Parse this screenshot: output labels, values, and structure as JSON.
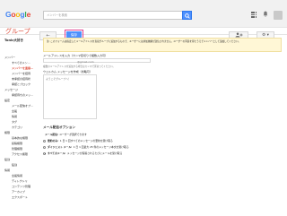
{
  "header": {
    "logo": "Google",
    "search_placeholder": "メンバーを検索",
    "app_name": "グループ"
  },
  "toolbar": {
    "back_label": "←",
    "save_label": "保存",
    "add_label": "+",
    "settings_label": "⚙ ▾"
  },
  "sidebar": {
    "group_title": "Tonic大好き",
    "items": [
      {
        "label": "メンバー",
        "kind": "cat"
      },
      {
        "label": "すべてのメン…",
        "kind": "sub"
      },
      {
        "label": "メンバーを直接…",
        "kind": "sub"
      },
      {
        "label": "メンバーを招待",
        "kind": "sub"
      },
      {
        "label": "未承認の招待状",
        "kind": "sub"
      },
      {
        "label": "承認とブロック",
        "kind": "sub"
      },
      {
        "label": "メッセージ",
        "kind": "cat"
      },
      {
        "label": "承認待ちのメッ…",
        "kind": "sub"
      },
      {
        "label": "設定",
        "kind": "cat"
      },
      {
        "label": "メール配信オプ…",
        "kind": "sub"
      },
      {
        "label": "全般",
        "kind": "sub"
      },
      {
        "label": "情報",
        "kind": "sub"
      },
      {
        "label": "タグ",
        "kind": "sub"
      },
      {
        "label": "カテゴリ",
        "kind": "sub"
      },
      {
        "label": "権限",
        "kind": "cat"
      },
      {
        "label": "基本的な権限",
        "kind": "sub"
      },
      {
        "label": "投稿権限",
        "kind": "sub"
      },
      {
        "label": "管理権限",
        "kind": "sub"
      },
      {
        "label": "アクセス権限",
        "kind": "sub"
      },
      {
        "label": "役割",
        "kind": "cat"
      },
      {
        "label": "役割",
        "kind": "sub"
      },
      {
        "label": "情報",
        "kind": "cat"
      },
      {
        "label": "全般情報",
        "kind": "sub"
      },
      {
        "label": "ディレクトリ",
        "kind": "sub"
      },
      {
        "label": "コンテンツ管理",
        "kind": "sub"
      },
      {
        "label": "アーカイブ",
        "kind": "sub"
      },
      {
        "label": "エクスポート",
        "kind": "sub"
      }
    ]
  },
  "main": {
    "notice": "注: このフォームは指定したメールアドレスを直接グループに追加するもので、ユーザーには参加依頼が送信されません。ユーザーの同意を得たうえでメンバーとして追加してください。",
    "email_label": "メールアドレスを入力（カンマ区切りで複数入力可）",
    "email_value": "@gmail.com",
    "email_hint": "複数のメールアドレスを追加する場合はカンマで区切ってください。",
    "welcome_label": "ウェルカム メッセージを作成（省略可）",
    "welcome_value": "ようこそグループへ！",
    "delivery_heading": "メール配信オプション",
    "delivery_desc_label": "メール配信: ",
    "delivery_desc": "ユーザーが選択できます",
    "options": [
      {
        "name": "要約のみ:",
        "desc": "1 日 1 回すべてのメッセージの要約を受け取る",
        "checked": false
      },
      {
        "name": "ダイジェスト メール:",
        "desc": "1 日 1 回最大 25 件のメッセージ本文を受け取る",
        "checked": false
      },
      {
        "name": "すべてのメール:",
        "desc": "メッセージが投稿されるたびにメールを受け取る",
        "checked": true
      }
    ]
  }
}
